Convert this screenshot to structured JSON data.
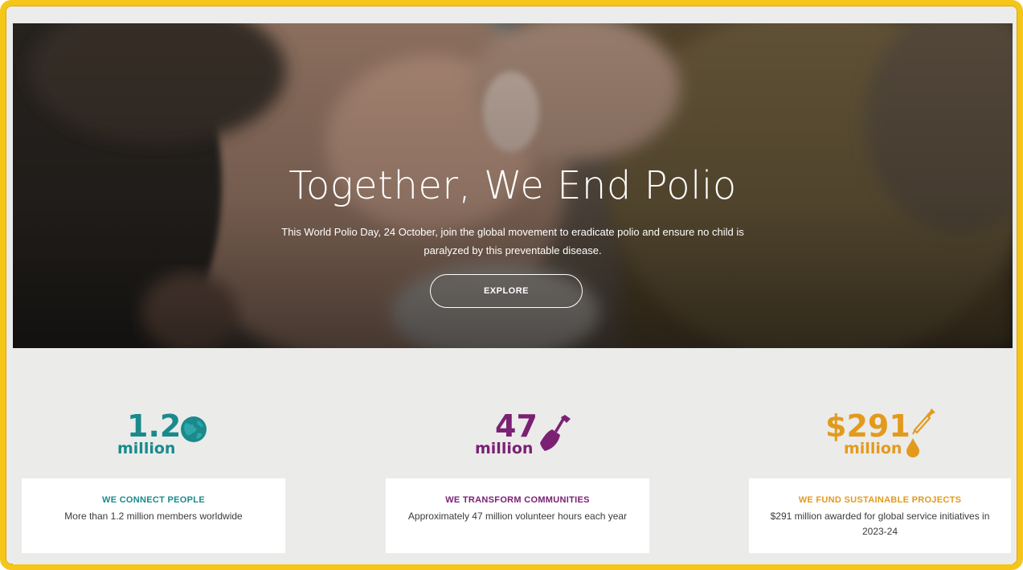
{
  "hero": {
    "title": "Together, We End Polio",
    "subtitle": "This World Polio Day, 24 October, join the global movement to eradicate polio and ensure no child is paralyzed by this preventable disease.",
    "cta_label": "EXPLORE"
  },
  "stats": [
    {
      "number": "1.2",
      "unit": "million",
      "icon": "globe-icon",
      "color": "#1a8a8c",
      "title": "WE CONNECT PEOPLE",
      "text": "More than 1.2 million members worldwide"
    },
    {
      "number": "47",
      "unit": "million",
      "icon": "shovel-icon",
      "color": "#7a2173",
      "title": "WE TRANSFORM COMMUNITIES",
      "text": "Approximately 47 million volunteer hours each year"
    },
    {
      "number": "$291",
      "unit": "million",
      "icon": "dropper-icon",
      "color": "#e39a1c",
      "title": "WE FUND SUSTAINABLE PROJECTS",
      "text": "$291 million awarded for global service initiatives in 2023-24"
    }
  ],
  "colors": {
    "frame": "#f5c518",
    "teal": "#1a8a8c",
    "purple": "#7a2173",
    "gold": "#e39a1c"
  }
}
